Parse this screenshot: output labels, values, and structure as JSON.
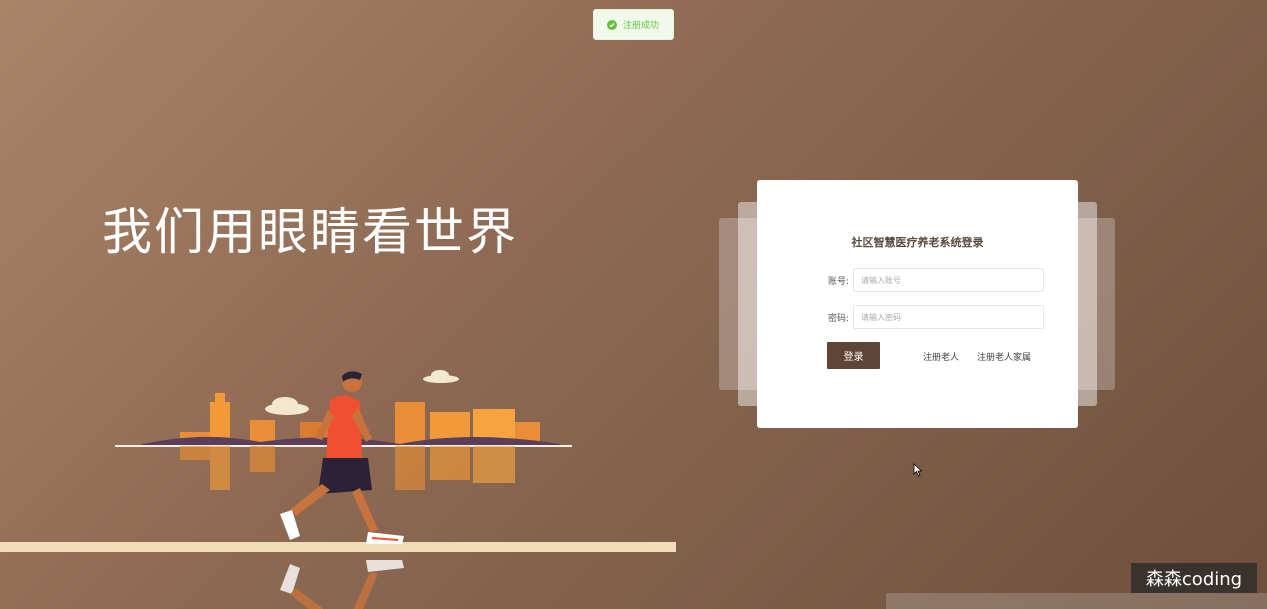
{
  "toast": {
    "text": "注册成功",
    "icon": "check-circle-icon",
    "color": "#67c23a"
  },
  "hero": {
    "slogan": "我们用眼睛看世界"
  },
  "login": {
    "title": "社区智慧医疗养老系统登录",
    "account_label": "账号:",
    "account_placeholder": "请输入账号",
    "password_label": "密码:",
    "password_placeholder": "请输入密码",
    "submit_label": "登录",
    "register_elder_label": "注册老人",
    "register_family_label": "注册老人家属"
  },
  "watermark": {
    "text": "森森coding"
  },
  "colors": {
    "accent": "#5e4535",
    "background": "#8e6a54"
  }
}
